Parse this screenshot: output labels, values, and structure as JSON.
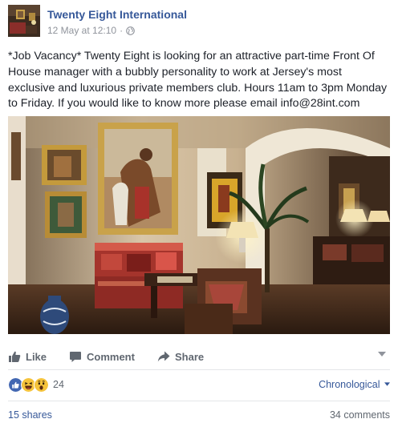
{
  "post": {
    "author": "Twenty Eight International",
    "timestamp": "12 May at 12:10",
    "separator": "·",
    "audience_icon": "globe-icon",
    "text": "*Job Vacancy* Twenty Eight is looking for an attractive part-time Front Of House manager with a bubbly personality to work at Jersey's most exclusive and luxurious private members club. Hours 11am to 3pm Monday to Friday. If you would like to know more please email info@28int.com"
  },
  "actions": {
    "like": "Like",
    "comment": "Comment",
    "share": "Share"
  },
  "reactions": {
    "types": [
      "like",
      "haha",
      "wow"
    ],
    "count": "24",
    "sort_label": "Chronological"
  },
  "footer": {
    "shares": "15 shares",
    "comments": "34 comments"
  },
  "colors": {
    "link": "#365899",
    "secondary_text": "#90949c",
    "like_blue": "#4267b2",
    "reaction_yellow": "#f5c33b"
  }
}
